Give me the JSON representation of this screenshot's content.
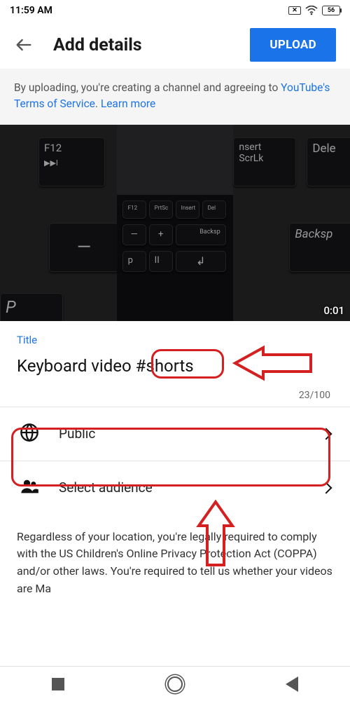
{
  "status": {
    "time": "11:59 AM",
    "battery": "56"
  },
  "header": {
    "title": "Add details",
    "upload_label": "UPLOAD"
  },
  "notice": {
    "text_before": "By uploading, you're creating a channel and agreeing to ",
    "link1": "YouTube's Terms of Service",
    "sep": ". ",
    "link2": "Learn more"
  },
  "preview": {
    "duration": "0:01"
  },
  "title_field": {
    "label": "Title",
    "value": "Keyboard video #shorts",
    "count": "23/100"
  },
  "options": {
    "visibility": "Public",
    "audience": "Select audience"
  },
  "disclaimer": "Regardless of your location, you're legally required to comply with the US Children's Online Privacy Protection Act (COPPA) and/or other laws. You're required to tell us whether your videos are Ma"
}
